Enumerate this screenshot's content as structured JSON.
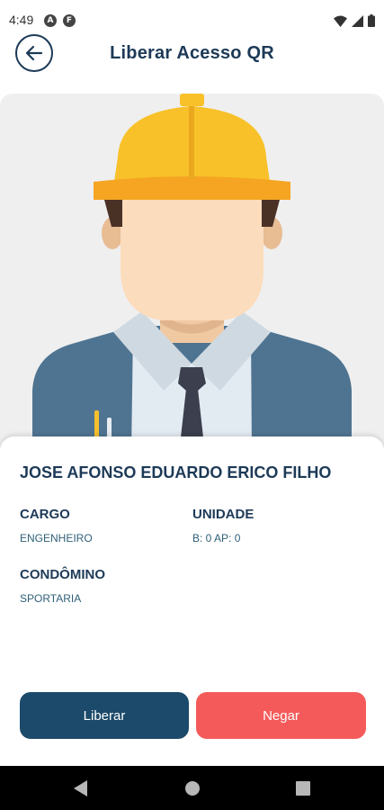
{
  "status_bar": {
    "time": "4:49",
    "left_icons": [
      "A",
      "F"
    ]
  },
  "header": {
    "title": "Liberar Acesso QR"
  },
  "person": {
    "name": "JOSE AFONSO EDUARDO ERICO FILHO",
    "fields": {
      "cargo_label": "CARGO",
      "cargo_value": "ENGENHEIRO",
      "unidade_label": "UNIDADE",
      "unidade_value": "B: 0 AP: 0",
      "condominio_label": "CONDÔMINO",
      "condominio_value": "SPORTARIA"
    }
  },
  "actions": {
    "liberar_label": "Liberar",
    "negar_label": "Negar"
  },
  "colors": {
    "primary": "#1c4a6a",
    "danger": "#f55a5a",
    "title": "#1d3a57"
  }
}
